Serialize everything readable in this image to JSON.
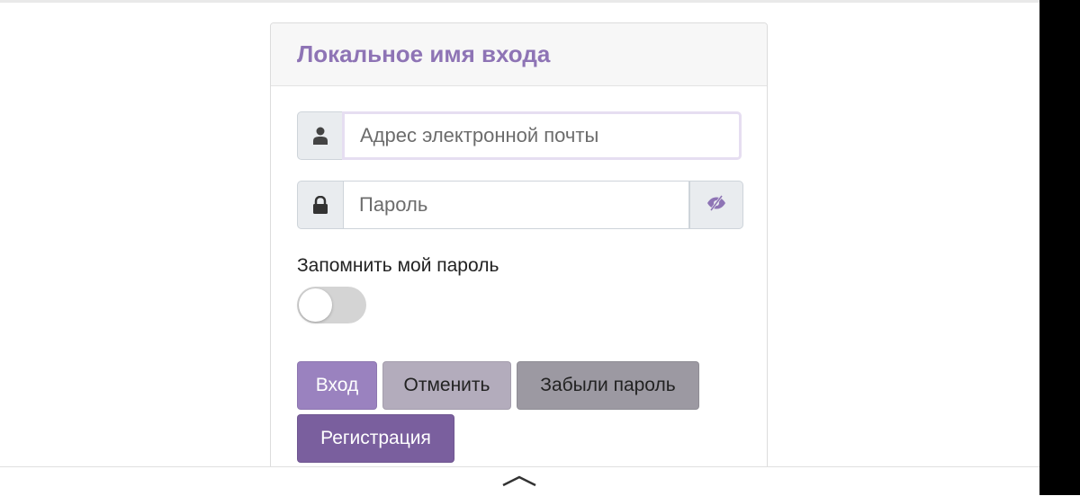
{
  "login_panel": {
    "title": "Локальное имя входа",
    "email": {
      "placeholder": "Адрес электронной почты",
      "value": ""
    },
    "password": {
      "placeholder": "Пароль",
      "value": ""
    },
    "remember": {
      "label": "Запомнить мой пароль",
      "enabled": false
    },
    "buttons": {
      "login": "Вход",
      "cancel": "Отменить",
      "forgot": "Забыли пароль",
      "register": "Регистрация"
    }
  },
  "icons": {
    "user": "user-icon",
    "lock": "lock-icon",
    "eye": "eye-slash-icon",
    "chevron": "chevron-up-icon"
  },
  "colors": {
    "accent": "#8e74b5",
    "login_button": "#9a82bf",
    "register_button": "#7a5f9e"
  }
}
